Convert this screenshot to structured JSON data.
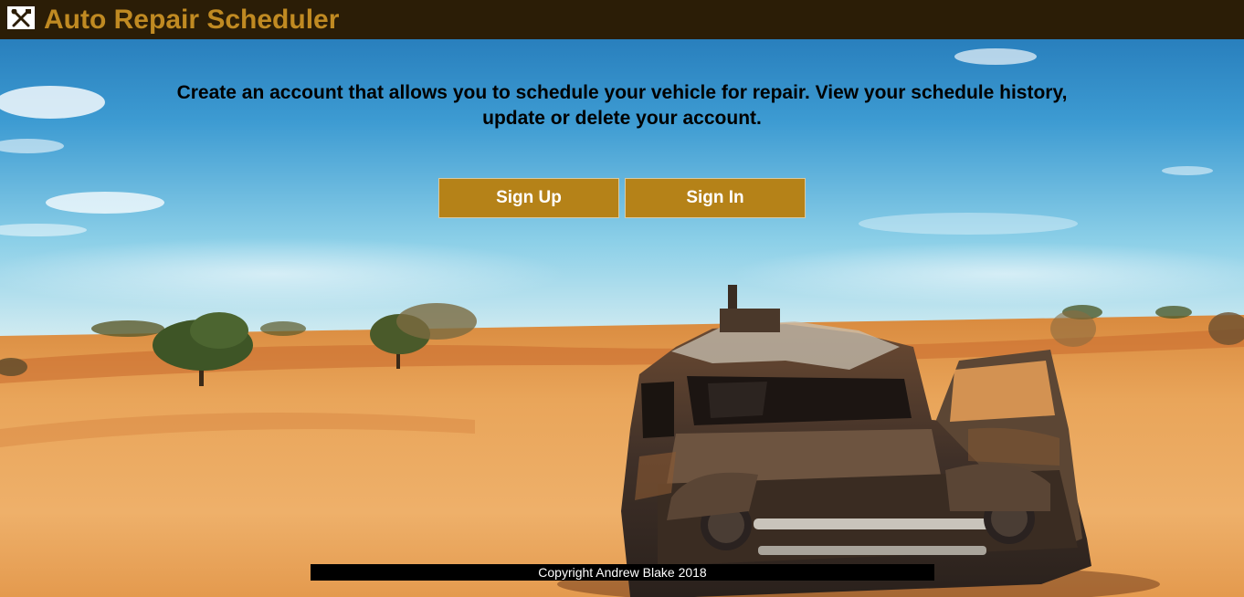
{
  "header": {
    "title": "Auto Repair Scheduler",
    "logo_icon": "wrench-screwdriver-icon",
    "background_color": "#2b1d06",
    "title_color": "#c08a22"
  },
  "main": {
    "intro_text": "Create an account that allows you to schedule your vehicle for repair. View your schedule history, update or delete your account.",
    "buttons": [
      {
        "label": "Sign Up",
        "color": "#b58218"
      },
      {
        "label": "Sign In",
        "color": "#b58218"
      }
    ]
  },
  "footer": {
    "copyright": "Copyright Andrew Blake 2018"
  }
}
